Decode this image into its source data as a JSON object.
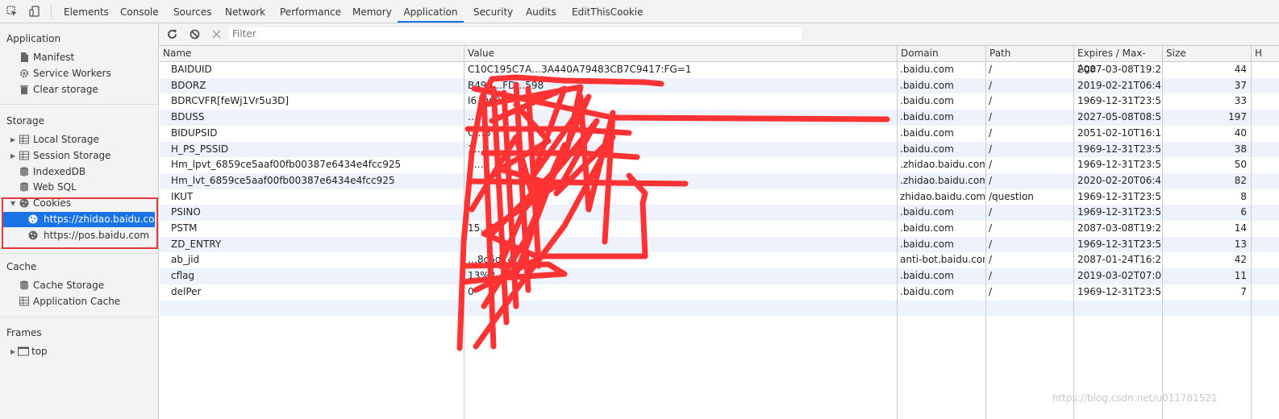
{
  "tabs": [
    "Elements",
    "Console",
    "Sources",
    "Network",
    "Performance",
    "Memory",
    "Application",
    "Security",
    "Audits",
    "EditThisCookie"
  ],
  "active_tab": "Application",
  "sidebar": {
    "application_header": "Application",
    "application_items": [
      "Manifest",
      "Service Workers",
      "Clear storage"
    ],
    "storage_header": "Storage",
    "storage_items": [
      "Local Storage",
      "Session Storage",
      "IndexedDB",
      "Web SQL",
      "Cookies"
    ],
    "cookie_sites": [
      "https://zhidao.baidu.com",
      "https://pos.baidu.com"
    ],
    "cache_header": "Cache",
    "cache_items": [
      "Cache Storage",
      "Application Cache"
    ],
    "frames_header": "Frames",
    "frames_items": [
      "top"
    ]
  },
  "filter_placeholder": "Filter",
  "columns": [
    "Name",
    "Value",
    "Domain",
    "Path",
    "Expires / Max-Age",
    "Size",
    "H"
  ],
  "rows": [
    {
      "name": "BAIDUID",
      "value": "C10C195C7A…3A440A79483CB7C9417:FG=1",
      "domain": ".baidu.com",
      "path": "/",
      "expires": "2087-03-08T19:2...",
      "size": "44"
    },
    {
      "name": "BDORZ",
      "value": "B490…FD…598",
      "domain": ".baidu.com",
      "path": "/",
      "expires": "2019-02-21T06:4...",
      "size": "37"
    },
    {
      "name": "BDRCVFR[feWj1Vr5u3D]",
      "value": "I6…w0",
      "domain": ".baidu.com",
      "path": "/",
      "expires": "1969-12-31T23:5...",
      "size": "33"
    },
    {
      "name": "BDUSS",
      "value": "…",
      "domain": ".baidu.com",
      "path": "/",
      "expires": "2027-05-08T08:5...",
      "size": "197"
    },
    {
      "name": "BIDUPSID",
      "value": "C…B",
      "domain": ".baidu.com",
      "path": "/",
      "expires": "2051-02-10T16:1...",
      "size": "40"
    },
    {
      "name": "H_PS_PSSID",
      "value": "1…",
      "domain": ".baidu.com",
      "path": "/",
      "expires": "1969-12-31T23:5...",
      "size": "38"
    },
    {
      "name": "Hm_lpvt_6859ce5aaf00fb00387e6434e4fcc925",
      "value": "1…",
      "domain": ".zhidao.baidu.com",
      "path": "/",
      "expires": "1969-12-31T23:5...",
      "size": "50"
    },
    {
      "name": "Hm_lvt_6859ce5aaf00fb00387e6434e4fcc925",
      "value": "1…",
      "domain": ".zhidao.baidu.com",
      "path": "/",
      "expires": "2020-02-20T06:4...",
      "size": "82"
    },
    {
      "name": "IKUT",
      "value": "",
      "domain": "zhidao.baidu.com",
      "path": "/question",
      "expires": "1969-12-31T23:5...",
      "size": "8"
    },
    {
      "name": "PSINO",
      "value": "",
      "domain": ".baidu.com",
      "path": "/",
      "expires": "1969-12-31T23:5...",
      "size": "6"
    },
    {
      "name": "PSTM",
      "value": "15…91",
      "domain": ".baidu.com",
      "path": "/",
      "expires": "2087-03-08T19:2...",
      "size": "14"
    },
    {
      "name": "ZD_ENTRY",
      "value": "",
      "domain": ".baidu.com",
      "path": "/",
      "expires": "1969-12-31T23:5...",
      "size": "13"
    },
    {
      "name": "ab_jid",
      "value": "…8c6d14",
      "domain": "anti-bot.baidu.com",
      "path": "/",
      "expires": "2087-01-24T16:2...",
      "size": "42"
    },
    {
      "name": "cflag",
      "value": "13%3…",
      "domain": ".baidu.com",
      "path": "/",
      "expires": "2019-03-02T07:0...",
      "size": "11"
    },
    {
      "name": "delPer",
      "value": "0",
      "domain": ".baidu.com",
      "path": "/",
      "expires": "1969-12-31T23:5...",
      "size": "7"
    }
  ],
  "watermark": "https://blog.csdn.net/u011781521",
  "colors": {
    "accent": "#1a73e8",
    "annotation_red": "#e53935",
    "scribble_red": "#ff3333",
    "selected_bg": "#1a73e8"
  }
}
